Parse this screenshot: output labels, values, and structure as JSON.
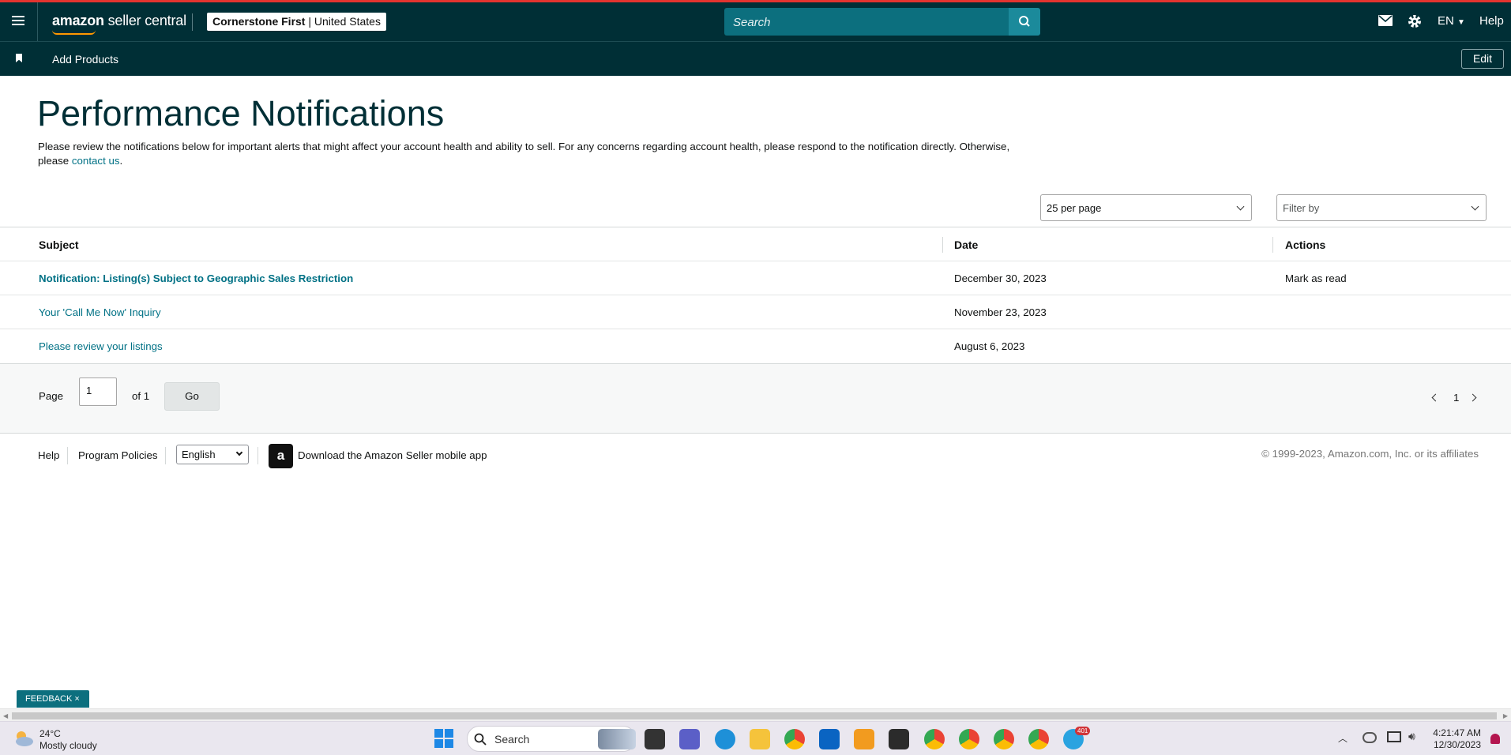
{
  "topbar": {
    "logo_main": "amazon",
    "logo_sub": " seller central",
    "store_name": "Cornerstone First",
    "store_region": "United States",
    "search_placeholder": "Search",
    "language": "EN",
    "help": "Help"
  },
  "subbar": {
    "add_products": "Add Products",
    "edit": "Edit"
  },
  "page": {
    "title": "Performance Notifications",
    "intro_text": "Please review the notifications below for important alerts that might affect your account health and ability to sell. For any concerns regarding account health, please respond to the notification directly. Otherwise, please ",
    "intro_link": "contact us",
    "intro_end": "."
  },
  "controls": {
    "per_page": "25 per page",
    "filter_by": "Filter by"
  },
  "table": {
    "headers": {
      "subject": "Subject",
      "date": "Date",
      "actions": "Actions"
    },
    "rows": [
      {
        "subject": "Notification: Listing(s) Subject to Geographic Sales Restriction",
        "date": "December 30, 2023",
        "action": "Mark as read",
        "unread": true
      },
      {
        "subject": "Your 'Call Me Now' Inquiry",
        "date": "November 23, 2023",
        "action": "",
        "unread": false
      },
      {
        "subject": "Please review your listings",
        "date": "August 6, 2023",
        "action": "",
        "unread": false
      }
    ]
  },
  "pager": {
    "page_label": "Page",
    "page_value": "1",
    "of_label": "of 1",
    "go": "Go",
    "current_page": "1"
  },
  "footer": {
    "help": "Help",
    "program_policies": "Program Policies",
    "language": "English",
    "app_download": "Download the Amazon Seller mobile app",
    "copyright": "© 1999-2023, Amazon.com, Inc. or its affiliates"
  },
  "feedback": {
    "label": "FEEDBACK",
    "close": "×"
  },
  "taskbar": {
    "weather_temp": "24°C",
    "weather_desc": "Mostly cloudy",
    "search": "Search",
    "time": "4:21:47 AM",
    "date": "12/30/2023",
    "telegram_badge": "401"
  },
  "colors": {
    "header_bg": "#002f36",
    "link": "#007185",
    "accent": "#0c6f7e"
  }
}
